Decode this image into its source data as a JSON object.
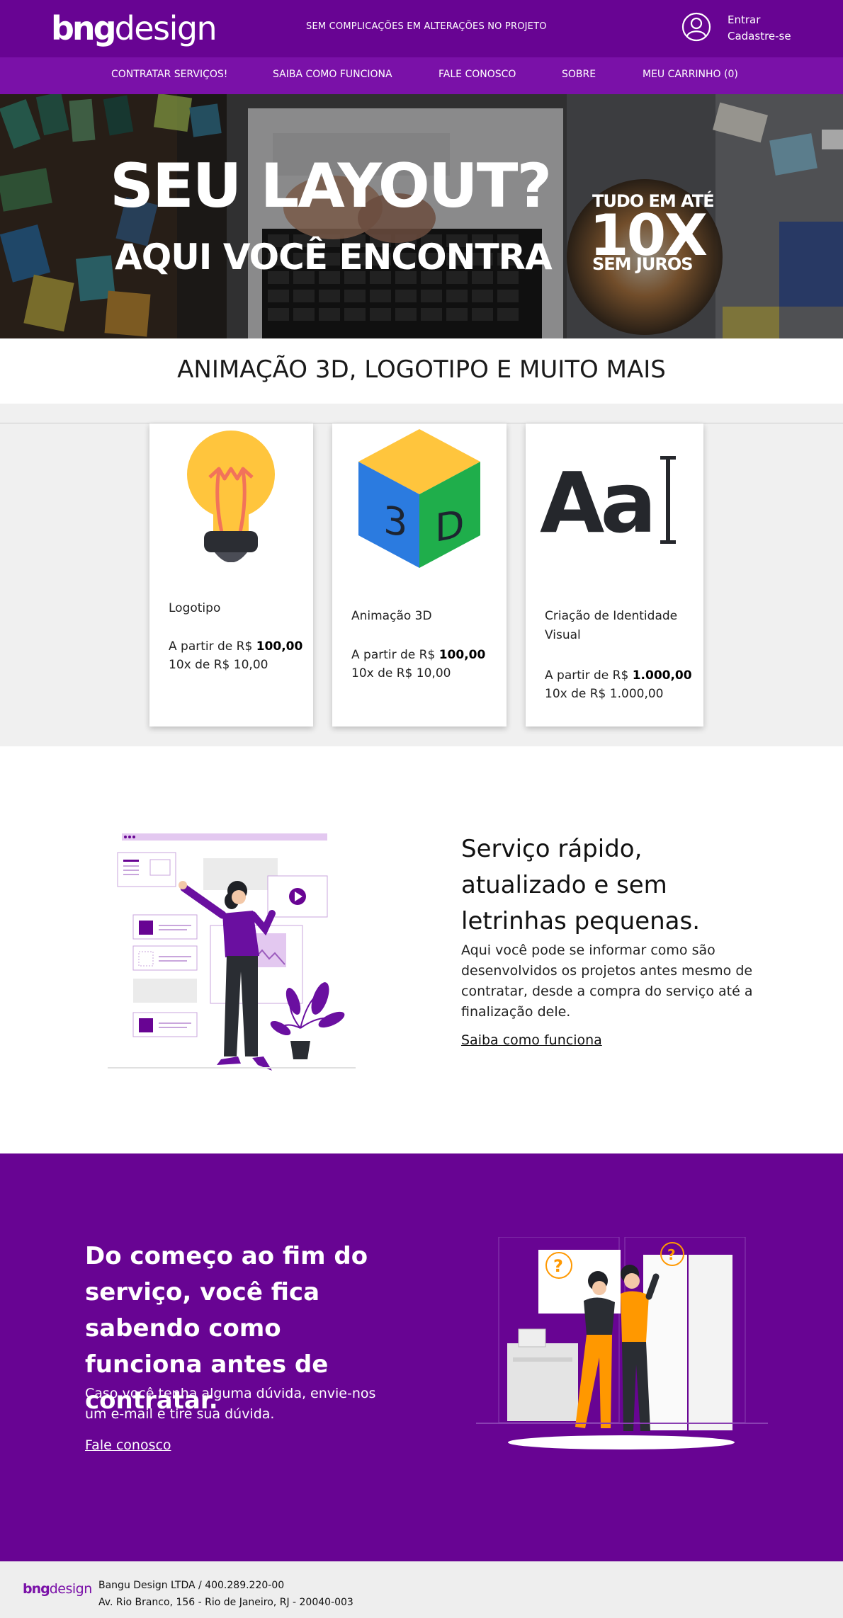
{
  "header": {
    "logo_bold": "bng",
    "logo_light": "design",
    "tagline": "SEM COMPLICAÇÕES EM ALTERAÇÕES NO PROJETO",
    "login_label": "Entrar",
    "signup_label": "Cadastre-se"
  },
  "nav": {
    "items": [
      {
        "label": "CONTRATAR SERVIÇOS!"
      },
      {
        "label": "SAIBA COMO FUNCIONA"
      },
      {
        "label": "FALE CONOSCO"
      },
      {
        "label": "SOBRE"
      },
      {
        "label": "MEU CARRINHO (0)"
      }
    ]
  },
  "hero": {
    "headline": "SEU LAYOUT?",
    "subheadline": "AQUI VOCÊ ENCONTRA",
    "promo_top": "TUDO EM ATÉ",
    "promo_big": "10X",
    "promo_bottom": "SEM JUROS"
  },
  "services_title": "ANIMAÇÃO 3D, LOGOTIPO E MUITO MAIS",
  "services": [
    {
      "icon": "lightbulb-icon",
      "title": "Logotipo",
      "price_prefix": "A partir de R$ ",
      "price": "100,00",
      "installments": "10x de R$ 10,00"
    },
    {
      "icon": "cube-3d-icon",
      "title": "Animação 3D",
      "price_prefix": "A partir de R$ ",
      "price": "100,00",
      "installments": "10x de R$ 10,00"
    },
    {
      "icon": "typography-icon",
      "title": "Criação de Identidade Visual",
      "price_prefix": "A partir de R$ ",
      "price": "1.000,00",
      "installments": "10x de R$ 1.000,00"
    }
  ],
  "cube_letters": [
    "3",
    "D"
  ],
  "type_glyph": "Aa",
  "feature1": {
    "title": "Serviço rápido, atualizado e sem letrinhas pequenas.",
    "description": "Aqui você pode se informar como são desenvolvidos os projetos antes mesmo de contratar, desde a compra do serviço até a finalização dele.",
    "link": "Saiba como funciona"
  },
  "feature2": {
    "title": "Do começo ao fim do serviço, você fica sabendo como funciona antes de contratar.",
    "description": "Caso você tenha alguma dúvida, envie-nos um e-mail e tire sua dúvida.",
    "link": "Fale conosco",
    "question_mark": "?"
  },
  "footer": {
    "logo_bold": "bng",
    "logo_light": "design",
    "company": "Bangu Design LTDA / 400.289.220-00",
    "address": "Av. Rio Branco, 156 - Rio de Janeiro, RJ - 20040-003"
  },
  "colors": {
    "brand_purple": "#680493",
    "nav_purple": "#7a11a8",
    "accent_orange": "#ff9800"
  }
}
